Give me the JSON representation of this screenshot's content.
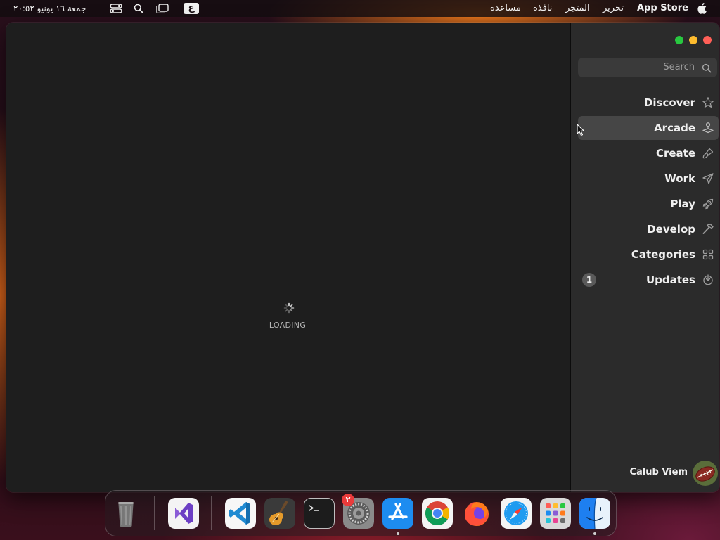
{
  "menubar": {
    "app_name": "App Store",
    "menus": [
      "تحرير",
      "المتجر",
      "نافذة",
      "مساعدة"
    ],
    "input_source": "ع",
    "datetime": "جمعة ١٦ يونيو ٢٠:٥٢"
  },
  "window": {
    "loading_text": "LOADING"
  },
  "sidebar": {
    "search_placeholder": "Search",
    "items": [
      {
        "label": "Discover",
        "icon": "star-icon"
      },
      {
        "label": "Arcade",
        "icon": "joystick-icon"
      },
      {
        "label": "Create",
        "icon": "brush-icon"
      },
      {
        "label": "Work",
        "icon": "paper-plane-icon"
      },
      {
        "label": "Play",
        "icon": "rocket-icon"
      },
      {
        "label": "Develop",
        "icon": "hammer-icon"
      },
      {
        "label": "Categories",
        "icon": "grid-icon"
      },
      {
        "label": "Updates",
        "icon": "download-icon",
        "badge": "1"
      }
    ],
    "active_item": "Arcade",
    "user_name": "Calub Viem"
  },
  "dock": {
    "apps": [
      "Trash",
      "Visual Studio",
      "Visual Studio Code",
      "GarageBand",
      "Terminal",
      "System Settings",
      "App Store",
      "Google Chrome",
      "Firefox",
      "Safari",
      "Launchpad",
      "Finder"
    ],
    "settings_badge": "٢"
  },
  "colors": {
    "sidebar_bg": "#2b2b2b",
    "content_bg": "#1e1e1e",
    "active_item_bg": "#464646",
    "close": "#ff5f57",
    "minimize": "#febc2e",
    "zoom": "#28c840"
  }
}
